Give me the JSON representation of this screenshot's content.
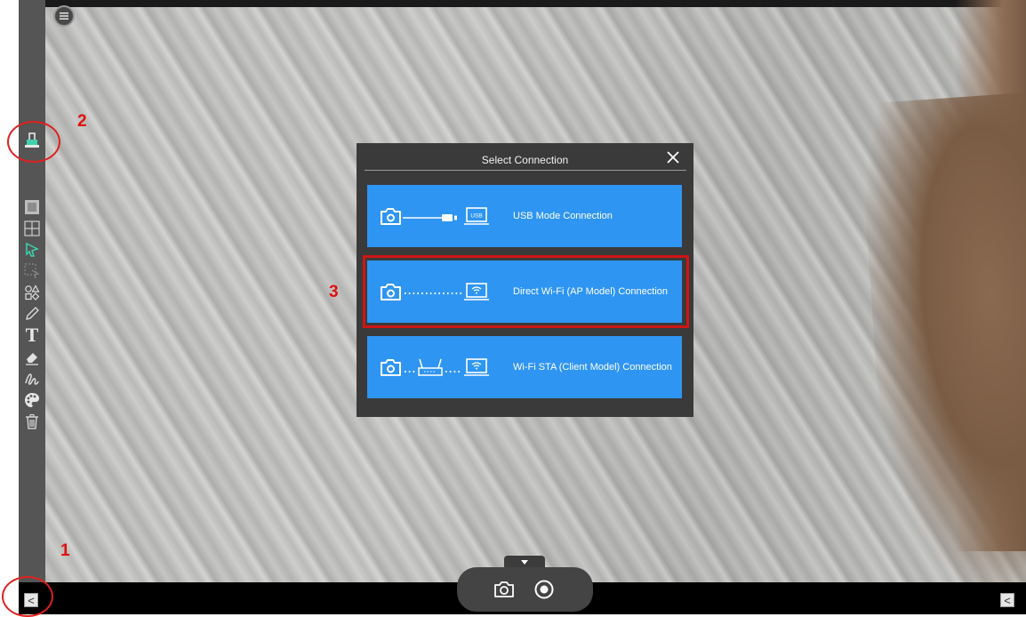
{
  "dialog": {
    "title": "Select Connection",
    "close_icon": "close-icon",
    "options": [
      {
        "label": "USB Mode Connection",
        "icon": "camera-usb-laptop-icon"
      },
      {
        "label": "Direct Wi-Fi (AP Model) Connection",
        "icon": "camera-wifi-direct-laptop-icon"
      },
      {
        "label": "Wi-Fi STA (Client Model) Connection",
        "icon": "camera-router-laptop-icon"
      }
    ],
    "usb_badge": "USB"
  },
  "sidebar": {
    "tools": [
      "connection-icon",
      "mosaic-icon",
      "grid-icon",
      "select-pointer-icon",
      "area-select-icon",
      "shapes-icon",
      "pen-icon",
      "text-icon",
      "eraser-icon",
      "freehand-icon",
      "palette-icon",
      "trash-icon"
    ],
    "text_tool_glyph": "T",
    "active_color": "#3fd1b0"
  },
  "annotations": {
    "n1": "1",
    "n2": "2",
    "n3": "3",
    "color": "#e01010"
  },
  "bottombar": {
    "left_button": "<",
    "right_button": "<",
    "camera_icon": "camera-icon",
    "record_icon": "record-icon",
    "expand_icon": "chevron-down-icon"
  },
  "colors": {
    "dialog_bg": "#3a3a3a",
    "option_bg": "#2f95f2",
    "sidebar_bg": "#555555"
  }
}
